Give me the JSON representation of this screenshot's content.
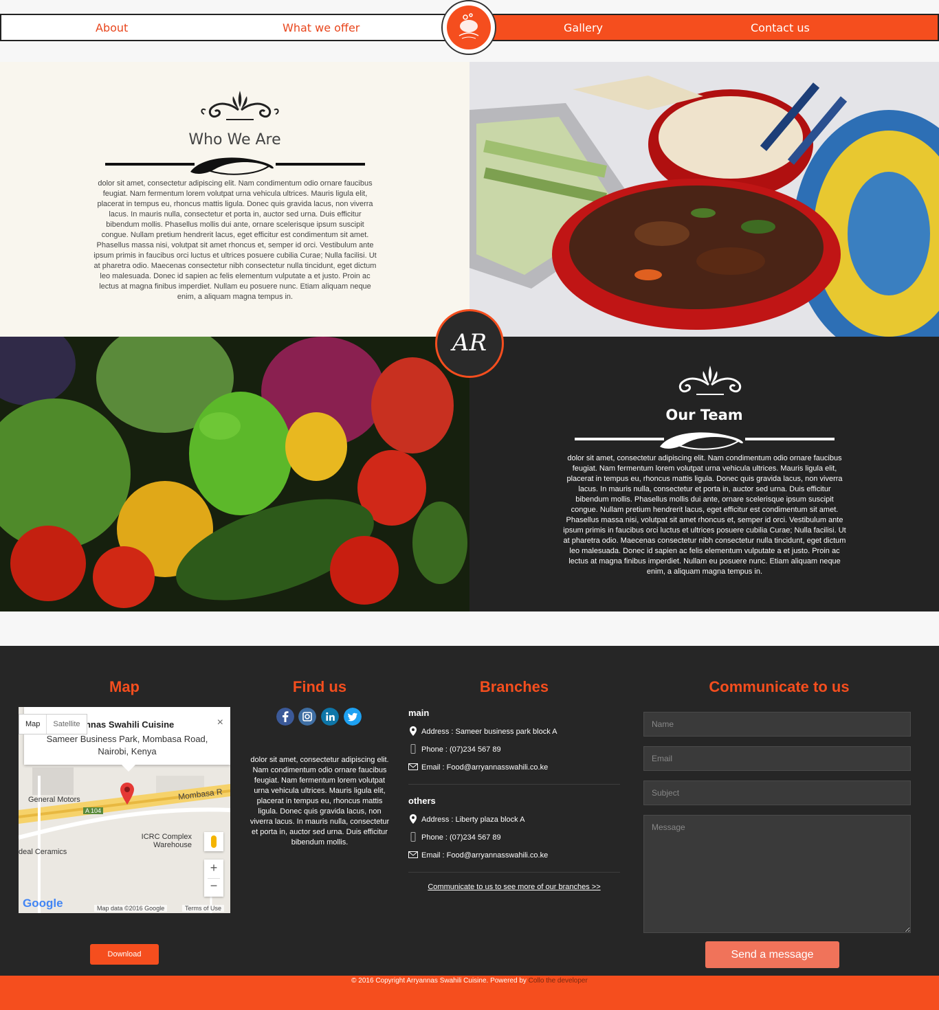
{
  "nav": {
    "about": "About",
    "offer": "What we offer",
    "gallery": "Gallery",
    "contact": "Contact us"
  },
  "who": {
    "title": "Who We Are",
    "body": "dolor sit amet, consectetur adipiscing elit. Nam condimentum odio ornare faucibus feugiat. Nam fermentum lorem volutpat urna vehicula ultrices. Mauris ligula elit, placerat in tempus eu, rhoncus mattis ligula. Donec quis gravida lacus, non viverra lacus. In mauris nulla, consectetur et porta in, auctor sed urna. Duis efficitur bibendum mollis. Phasellus mollis dui ante, ornare scelerisque ipsum suscipit congue. Nullam pretium hendrerit lacus, eget efficitur est condimentum sit amet. Phasellus massa nisi, volutpat sit amet rhoncus et, semper id orci. Vestibulum ante ipsum primis in faucibus orci luctus et ultrices posuere cubilia Curae; Nulla facilisi. Ut at pharetra odio. Maecenas consectetur nibh consectetur nulla tincidunt, eget dictum leo malesuada. Donec id sapien ac felis elementum vulputate a et justo. Proin ac lectus at magna finibus imperdiet. Nullam eu posuere nunc. Etiam aliquam neque enim, a aliquam magna tempus in."
  },
  "badge": "AR",
  "team": {
    "title": "Our Team",
    "body": "dolor sit amet, consectetur adipiscing elit. Nam condimentum odio ornare faucibus feugiat. Nam fermentum lorem volutpat urna vehicula ultrices. Mauris ligula elit, placerat in tempus eu, rhoncus mattis ligula. Donec quis gravida lacus, non viverra lacus. In mauris nulla, consectetur et porta in, auctor sed urna. Duis efficitur bibendum mollis. Phasellus mollis dui ante, ornare scelerisque ipsum suscipit congue. Nullam pretium hendrerit lacus, eget efficitur est condimentum sit amet. Phasellus massa nisi, volutpat sit amet rhoncus et, semper id orci. Vestibulum ante ipsum primis in faucibus orci luctus et ultrices posuere cubilia Curae; Nulla facilisi. Ut at pharetra odio. Maecenas consectetur nibh consectetur nulla tincidunt, eget dictum leo malesuada. Donec id sapien ac felis elementum vulputate a et justo. Proin ac lectus at magna finibus imperdiet. Nullam eu posuere nunc. Etiam aliquam neque enim, a aliquam magna tempus in."
  },
  "footer": {
    "map": {
      "title": "Map",
      "tab_map": "Map",
      "tab_satellite": "Satellite",
      "place_name": "annas Swahili Cuisine",
      "place_addr": "Sameer Business Park, Mombasa Road, Nairobi, Kenya",
      "label_road": "Mombasa R",
      "label_gm": "General Motors",
      "label_a104": "A 104",
      "label_icrc": "ICRC Complex Warehouse",
      "label_ceramics": "deal Ceramics",
      "google": "Google",
      "map_data": "Map data ©2016 Google",
      "terms": "Terms of Use",
      "download": "Download"
    },
    "findus": {
      "title": "Find us",
      "body": "dolor sit amet, consectetur adipiscing elit. Nam condimentum odio ornare faucibus feugiat. Nam fermentum lorem volutpat urna vehicula ultrices. Mauris ligula elit, placerat in tempus eu, rhoncus mattis ligula. Donec quis gravida lacus, non viverra lacus. In mauris nulla, consectetur et porta in, auctor sed urna. Duis efficitur bibendum mollis."
    },
    "branches": {
      "title": "Branches",
      "main": {
        "name": "main",
        "address": "Address : Sameer business park block A",
        "phone": "Phone : (07)234 567 89",
        "email": "Email : Food@arryannasswahili.co.ke"
      },
      "others": {
        "name": "others",
        "address": "Address : Liberty plaza block A",
        "phone": "Phone : (07)234 567 89",
        "email": "Email : Food@arryannasswahili.co.ke"
      },
      "more_link": "Communicate to us to see more of our branches >>"
    },
    "contact": {
      "title": "Communicate to us",
      "name_ph": "Name",
      "email_ph": "Email",
      "subject_ph": "Subject",
      "message_ph": "Message",
      "send": "Send a message"
    },
    "copyright": "© 2016 Copyright Arryannas Swahili Cuisine. Powered by ",
    "developer": "Collo the developer"
  },
  "colors": {
    "accent": "#f54e1e",
    "dark": "#262626",
    "cream": "#f9f6ee"
  }
}
